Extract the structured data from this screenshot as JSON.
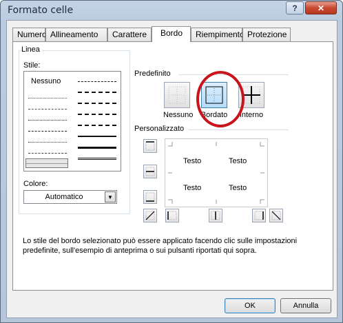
{
  "window": {
    "title": "Formato celle",
    "help_icon": "question-mark",
    "close_icon": "x"
  },
  "tabs": [
    {
      "label": "Numero",
      "active": false
    },
    {
      "label": "Allineamento",
      "active": false
    },
    {
      "label": "Carattere",
      "active": false
    },
    {
      "label": "Bordo",
      "active": true
    },
    {
      "label": "Riempimento",
      "active": false
    },
    {
      "label": "Protezione",
      "active": false
    }
  ],
  "linea": {
    "group_label": "Linea",
    "stile_label": "Stile:",
    "none_option": "Nessuno",
    "colore_label": "Colore:",
    "colore_value": "Automatico"
  },
  "predefinito": {
    "group_label": "Predefinito",
    "presets": [
      {
        "label": "Nessuno",
        "selected": false
      },
      {
        "label": "Bordato",
        "selected": true
      },
      {
        "label": "Interno",
        "selected": false
      }
    ],
    "highlight_color": "#c8141a"
  },
  "personalizzato": {
    "group_label": "Personalizzato",
    "preview_text": [
      "Testo",
      "Testo",
      "Testo",
      "Testo"
    ]
  },
  "description": "Lo stile del bordo selezionato può essere applicato facendo clic sulle impostazioni predefinite, sull'esempio di anteprima o sui pulsanti riportati qui sopra.",
  "footer": {
    "ok_label": "OK",
    "cancel_label": "Annulla"
  }
}
